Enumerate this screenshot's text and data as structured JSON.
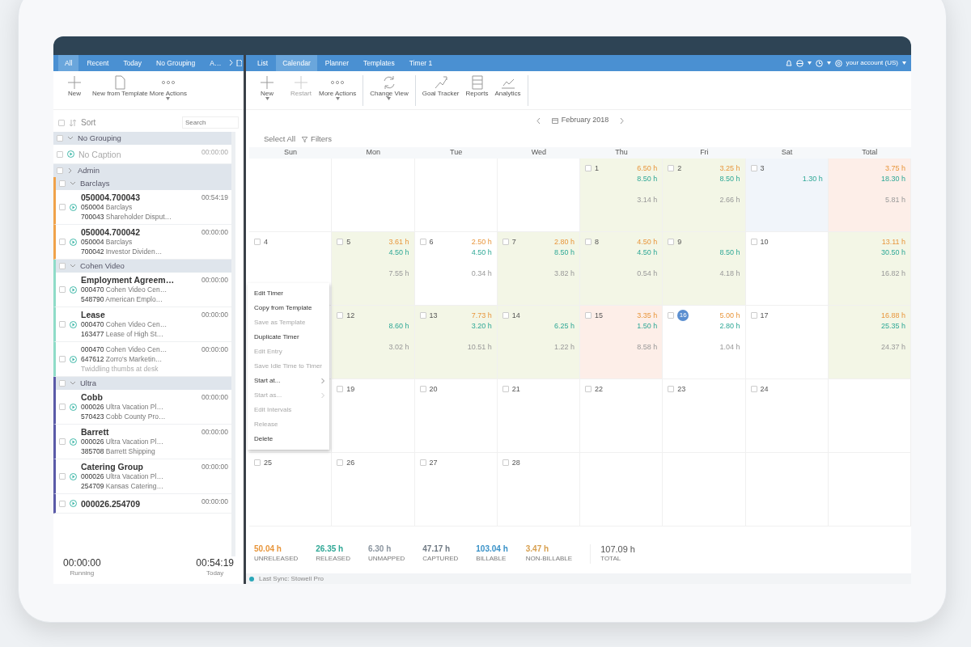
{
  "top_bar": {
    "account": "your account (US)"
  },
  "left_panel": {
    "tabs": [
      {
        "label": "All",
        "selected": true
      },
      {
        "label": "Recent",
        "selected": false
      },
      {
        "label": "Today",
        "selected": false
      },
      {
        "label": "No Grouping",
        "selected": false
      },
      {
        "label": "A…",
        "selected": false
      }
    ],
    "toolbar": [
      {
        "label": "New",
        "kind": "plus",
        "caret": false
      },
      {
        "label": "New from Template",
        "kind": "page",
        "caret": false
      },
      {
        "label": "More Actions",
        "kind": "dots",
        "caret": true
      }
    ],
    "select_checkbox": {
      "checked": false
    },
    "sort_label": "Sort",
    "search": {
      "placeholder": "Search"
    },
    "groups": [
      {
        "name": "No Grouping",
        "expanded": true,
        "checked": false,
        "timers": [
          {
            "title": "No Caption",
            "muted": true,
            "checked": false,
            "time": "00:00:00"
          }
        ]
      },
      {
        "name": "Admin",
        "expanded": false,
        "checked": false
      },
      {
        "name": "Barclays",
        "expanded": true,
        "checked": false,
        "color": "#f0a24a",
        "timers": [
          {
            "title": "050004.700043",
            "muted": false,
            "checked": false,
            "time": "00:54:19",
            "lines": [
              {
                "code": "050004",
                "text": "Barclays"
              },
              {
                "code": "700043",
                "text": "Shareholder Disput…"
              }
            ]
          },
          {
            "title": "050004.700042",
            "muted": false,
            "checked": false,
            "time": "00:00:00",
            "lines": [
              {
                "code": "050004",
                "text": "Barclays"
              },
              {
                "code": "700042",
                "text": "Investor Dividen…"
              }
            ]
          }
        ]
      },
      {
        "name": "Cohen Video",
        "expanded": true,
        "checked": false,
        "color": "#8fdcc8",
        "timers": [
          {
            "title": "Employment Agreem…",
            "muted": false,
            "checked": false,
            "time": "00:00:00",
            "lines": [
              {
                "code": "000470",
                "text": "Cohen Video Cen…"
              },
              {
                "code": "548790",
                "text": "American Emplo…"
              }
            ]
          },
          {
            "title": "Lease",
            "muted": false,
            "checked": false,
            "time": "00:00:00",
            "lines": [
              {
                "code": "000470",
                "text": "Cohen Video Cen…"
              },
              {
                "code": "163477",
                "text": "Lease of High St…"
              }
            ]
          },
          {
            "muted": false,
            "checked": false,
            "time": "00:00:00",
            "lines": [
              {
                "code": "000470",
                "text": "Cohen Video Cen…"
              },
              {
                "code": "647612",
                "text": "Zorro's Marketin…"
              }
            ],
            "note": "Twiddling thumbs at desk"
          }
        ]
      },
      {
        "name": "Ultra",
        "expanded": true,
        "checked": false,
        "color": "#5a5aa8",
        "timers": [
          {
            "title": "Cobb",
            "muted": false,
            "checked": false,
            "time": "00:00:00",
            "lines": [
              {
                "code": "000026",
                "text": "Ultra Vacation Pl…"
              },
              {
                "code": "570423",
                "text": "Cobb County Pro…"
              }
            ]
          },
          {
            "title": "Barrett",
            "muted": false,
            "checked": false,
            "time": "00:00:00",
            "lines": [
              {
                "code": "000026",
                "text": "Ultra Vacation Pl…"
              },
              {
                "code": "385708",
                "text": "Barrett Shipping"
              }
            ]
          },
          {
            "title": "Catering Group",
            "muted": false,
            "checked": false,
            "time": "00:00:00",
            "lines": [
              {
                "code": "000026",
                "text": "Ultra Vacation Pl…"
              },
              {
                "code": "254709",
                "text": "Kansas Catering…"
              }
            ]
          },
          {
            "title": "000026.254709",
            "muted": false,
            "checked": false,
            "time": "00:00:00"
          }
        ]
      }
    ],
    "footer": [
      {
        "time": "00:00:00",
        "label": "Running"
      },
      {
        "time": "00:54:19",
        "label": "Today"
      }
    ]
  },
  "main": {
    "tabs": [
      {
        "label": "List",
        "selected": false
      },
      {
        "label": "Calendar",
        "selected": true
      },
      {
        "label": "Planner",
        "selected": false
      },
      {
        "label": "Templates",
        "selected": false
      },
      {
        "label": "Timer 1",
        "selected": false
      }
    ],
    "toolbar": [
      {
        "label": "New",
        "kind": "plus",
        "caret": true,
        "disabled": false,
        "group_end": false
      },
      {
        "label": "Restart",
        "kind": "plus",
        "caret": false,
        "disabled": true,
        "group_end": false
      },
      {
        "label": "More Actions",
        "kind": "dots",
        "caret": true,
        "disabled": false,
        "group_end": true
      },
      {
        "label": "Change View",
        "kind": "refresh",
        "caret": true,
        "disabled": false,
        "group_end": true
      },
      {
        "label": "Goal Tracker",
        "kind": "target",
        "caret": false,
        "disabled": false,
        "group_end": false
      },
      {
        "label": "Reports",
        "kind": "table",
        "caret": false,
        "disabled": false,
        "group_end": false
      },
      {
        "label": "Analytics",
        "kind": "chart",
        "caret": false,
        "disabled": false,
        "group_end": true
      }
    ],
    "month": "February 2018",
    "select_all": "Select All",
    "filters": "Filters",
    "weekdays": [
      "Sun",
      "Mon",
      "Tue",
      "Wed",
      "Thu",
      "Fri",
      "Sat",
      "Total"
    ],
    "weeks": [
      [
        {
          "kind": "blank"
        },
        {
          "kind": "blank"
        },
        {
          "kind": "blank"
        },
        {
          "kind": "blank"
        },
        {
          "kind": "day",
          "day": "1",
          "checked": false,
          "today": false,
          "color": "#f3f6e6",
          "top_value": "6.50 h",
          "middle_value": "8.50 h",
          "bottom_value": "3.14 h"
        },
        {
          "kind": "day",
          "day": "2",
          "checked": false,
          "today": false,
          "color": "#f3f6e6",
          "top_value": "3.25 h",
          "middle_value": "8.50 h",
          "bottom_value": "2.66 h"
        },
        {
          "kind": "day",
          "day": "3",
          "checked": false,
          "today": false,
          "color": "#f1f5fa",
          "middle_value": "1.30 h"
        },
        {
          "kind": "total",
          "color": "#fdeee8",
          "top_value": "3.75 h",
          "middle_value": "18.30 h",
          "bottom_value": "5.81 h"
        }
      ],
      [
        {
          "kind": "day",
          "day": "4",
          "checked": false,
          "today": false
        },
        {
          "kind": "day",
          "day": "5",
          "checked": false,
          "today": false,
          "color": "#f3f6e6",
          "top_value": "3.61 h",
          "middle_value": "4.50 h",
          "bottom_value": "7.55 h"
        },
        {
          "kind": "day",
          "day": "6",
          "checked": false,
          "today": false,
          "top_value": "2.50 h",
          "middle_value": "4.50 h",
          "bottom_value": "0.34 h"
        },
        {
          "kind": "day",
          "day": "7",
          "checked": false,
          "today": false,
          "color": "#f3f6e6",
          "top_value": "2.80 h",
          "middle_value": "8.50 h",
          "bottom_value": "3.82 h"
        },
        {
          "kind": "day",
          "day": "8",
          "checked": false,
          "today": false,
          "color": "#f3f6e6",
          "top_value": "4.50 h",
          "middle_value": "4.50 h",
          "bottom_value": "0.54 h"
        },
        {
          "kind": "day",
          "day": "9",
          "checked": false,
          "today": false,
          "color": "#f3f6e6",
          "middle_value": "8.50 h",
          "bottom_value": "4.18 h"
        },
        {
          "kind": "day",
          "day": "10",
          "checked": false,
          "today": false
        },
        {
          "kind": "total",
          "color": "#f3f6e6",
          "top_value": "13.11 h",
          "middle_value": "30.50 h",
          "bottom_value": "16.82 h"
        }
      ],
      [
        {
          "kind": "blank"
        },
        {
          "kind": "day",
          "day": "12",
          "checked": false,
          "today": false,
          "color": "#f3f6e6",
          "middle_value": "8.60 h",
          "bottom_value": "3.02 h"
        },
        {
          "kind": "day",
          "day": "13",
          "checked": false,
          "today": false,
          "color": "#f3f6e6",
          "top_value": "7.73 h",
          "middle_value": "3.20 h",
          "bottom_value": "10.51 h"
        },
        {
          "kind": "day",
          "day": "14",
          "checked": false,
          "today": false,
          "color": "#f3f6e6",
          "middle_value": "6.25 h",
          "bottom_value": "1.22 h"
        },
        {
          "kind": "day",
          "day": "15",
          "checked": false,
          "today": false,
          "color": "#fdeee8",
          "top_value": "3.35 h",
          "middle_value": "1.50 h",
          "bottom_value": "8.58 h"
        },
        {
          "kind": "day",
          "day": "16",
          "checked": false,
          "today": true,
          "top_value": "5.00 h",
          "middle_value": "2.80 h",
          "bottom_value": "1.04 h"
        },
        {
          "kind": "day",
          "day": "17",
          "checked": false,
          "today": false
        },
        {
          "kind": "total",
          "color": "#f3f6e6",
          "top_value": "16.88 h",
          "middle_value": "25.35 h",
          "bottom_value": "24.37 h"
        }
      ],
      [
        {
          "kind": "blank"
        },
        {
          "kind": "day",
          "day": "19",
          "checked": false,
          "today": false
        },
        {
          "kind": "day",
          "day": "20",
          "checked": false,
          "today": false
        },
        {
          "kind": "day",
          "day": "21",
          "checked": false,
          "today": false
        },
        {
          "kind": "day",
          "day": "22",
          "checked": false,
          "today": false
        },
        {
          "kind": "day",
          "day": "23",
          "checked": false,
          "today": false
        },
        {
          "kind": "day",
          "day": "24",
          "checked": false,
          "today": false
        },
        {
          "kind": "blank"
        }
      ],
      [
        {
          "kind": "day",
          "day": "25",
          "checked": false,
          "today": false
        },
        {
          "kind": "day",
          "day": "26",
          "checked": false,
          "today": false
        },
        {
          "kind": "day",
          "day": "27",
          "checked": false,
          "today": false
        },
        {
          "kind": "day",
          "day": "28",
          "checked": false,
          "today": false
        },
        {
          "kind": "blank"
        },
        {
          "kind": "blank"
        },
        {
          "kind": "blank"
        },
        {
          "kind": "blank"
        }
      ]
    ],
    "context_menu": [
      {
        "label": "Edit Timer",
        "disabled": false,
        "submenu": false
      },
      {
        "label": "Copy from Template",
        "disabled": false,
        "submenu": false
      },
      {
        "label": "Save as Template",
        "disabled": true,
        "submenu": false
      },
      {
        "label": "Duplicate Timer",
        "disabled": false,
        "submenu": false
      },
      {
        "label": "Edit Entry",
        "disabled": true,
        "submenu": false
      },
      {
        "label": "Save Idle Time to Timer",
        "disabled": true,
        "submenu": false
      },
      {
        "label": "Start at...",
        "disabled": false,
        "submenu": true
      },
      {
        "label": "Start as...",
        "disabled": true,
        "submenu": true
      },
      {
        "label": "Edit Intervals",
        "disabled": true,
        "submenu": false
      },
      {
        "label": "Release",
        "disabled": true,
        "submenu": false
      },
      {
        "label": "Delete",
        "disabled": false,
        "submenu": false
      }
    ],
    "summary": [
      {
        "value": "50.04 h",
        "label": "UNRELEASED",
        "color": "#e8963c"
      },
      {
        "value": "26.35 h",
        "label": "RELEASED",
        "color": "#2fa896"
      },
      {
        "value": "6.30 h",
        "label": "UNMAPPED",
        "color": "#8c96a0"
      },
      {
        "value": "47.17 h",
        "label": "CAPTURED",
        "color": "#707a84"
      },
      {
        "value": "103.04 h",
        "label": "BILLABLE",
        "color": "#3a92c8"
      },
      {
        "value": "3.47 h",
        "label": "NON-BILLABLE",
        "color": "#d8a050"
      }
    ],
    "total": {
      "value": "107.09 h",
      "label": "TOTAL"
    },
    "status": "Last Sync: Stowell Pro"
  }
}
